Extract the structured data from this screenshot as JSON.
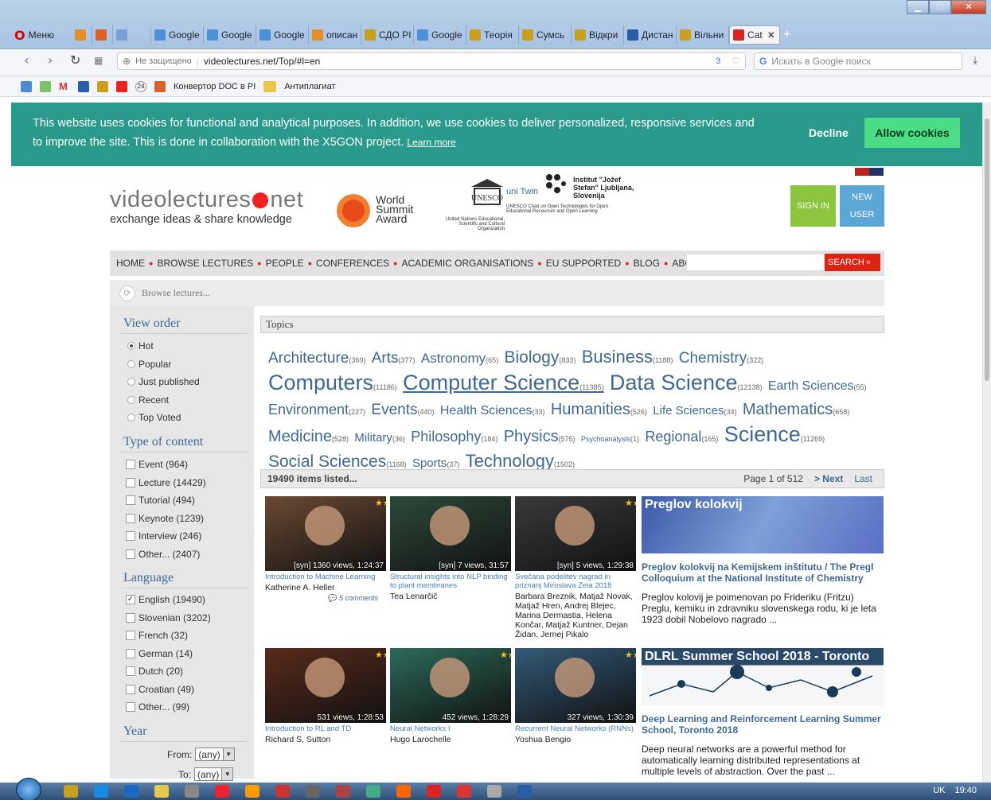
{
  "browser": {
    "menu_label": "Меню",
    "tabs": [
      "Google",
      "Google",
      "Google",
      "описан",
      "СДО PI",
      "Google",
      "Теорія",
      "Сумсь",
      "Відкри",
      "Дистан",
      "Вільни",
      "Cat"
    ],
    "address": {
      "not_secure": "Не защищено",
      "url": "videolectures.net/Top/#l=en",
      "badge": "3"
    },
    "search_placeholder": "Искать в Google поиск",
    "bookmarks": [
      "Конвертор DOC в PI",
      "Антиплагиат"
    ],
    "bookmark_badge": "24"
  },
  "cookie": {
    "text": "This website uses cookies for functional and analytical purposes. In addition, we use cookies to deliver personalized, responsive services and to improve the site. This is done in collaboration with the X5GON project.",
    "learn_more": "Learn more",
    "decline": "Decline",
    "allow": "Allow cookies"
  },
  "header": {
    "logo_main": "videolectures",
    "logo_net": "net",
    "tagline": "exchange ideas & share knowledge",
    "award": [
      "World",
      "Summit",
      "Award"
    ],
    "unesco_caption": "United Nations Educational, Scientific and Cultural Organization",
    "unesco_logo": "UNESCO",
    "unitwin_logo": "uni Twin",
    "unitwin_caption": "UNESCO Chair on Open Technologies for Open Educational Resources and Open Learning",
    "ijs": "Institut \"Jožef Stefan\" Ljubljana, Slovenija",
    "sign_in": "SIGN IN",
    "new_user": [
      "NEW",
      "USER"
    ]
  },
  "nav": {
    "items": [
      "HOME",
      "BROWSE LECTURES",
      "PEOPLE",
      "CONFERENCES",
      "ACADEMIC ORGANISATIONS",
      "EU SUPPORTED",
      "BLOG",
      "ABOUT US"
    ],
    "search": "SEARCH"
  },
  "browse": "Browse lectures...",
  "sidebar": {
    "view_order_title": "View order",
    "view_order": [
      "Hot",
      "Popular",
      "Just published",
      "Recent",
      "Top Voted"
    ],
    "type_title": "Type of content",
    "types": [
      "Event (964)",
      "Lecture (14429)",
      "Tutorial (494)",
      "Keynote (1239)",
      "Interview (246)",
      "Other... (2407)"
    ],
    "language_title": "Language",
    "languages": [
      "English (19490)",
      "Slovenian (3202)",
      "French (32)",
      "German (14)",
      "Dutch (20)",
      "Croatian (49)",
      "Other... (99)"
    ],
    "year_title": "Year",
    "from_label": "From:",
    "to_label": "To:",
    "any": "(any)"
  },
  "topics": {
    "title": "Topics",
    "items": [
      {
        "name": "Architecture",
        "count": "(369)",
        "size": 19
      },
      {
        "name": "Arts",
        "count": "(377)",
        "size": 19
      },
      {
        "name": "Astronomy",
        "count": "(65)",
        "size": 17
      },
      {
        "name": "Biology",
        "count": "(833)",
        "size": 21
      },
      {
        "name": "Business",
        "count": "(1188)",
        "size": 22
      },
      {
        "name": "Chemistry",
        "count": "(322)",
        "size": 19
      },
      {
        "name": "Computers",
        "count": "(11186)",
        "size": 27
      },
      {
        "name": "Computer Science",
        "count": "(11385)",
        "size": 27,
        "underline": true
      },
      {
        "name": "Data Science",
        "count": "(12138)",
        "size": 27
      },
      {
        "name": "Earth Sciences",
        "count": "(55)",
        "size": 16
      },
      {
        "name": "Environment",
        "count": "(227)",
        "size": 18
      },
      {
        "name": "Events",
        "count": "(440)",
        "size": 19
      },
      {
        "name": "Health Sciences",
        "count": "(33)",
        "size": 16
      },
      {
        "name": "Humanities",
        "count": "(526)",
        "size": 20
      },
      {
        "name": "Life Sciences",
        "count": "(34)",
        "size": 15
      },
      {
        "name": "Mathematics",
        "count": "(658)",
        "size": 20
      },
      {
        "name": "Medicine",
        "count": "(528)",
        "size": 20
      },
      {
        "name": "Military",
        "count": "(36)",
        "size": 15
      },
      {
        "name": "Philosophy",
        "count": "(184)",
        "size": 18
      },
      {
        "name": "Physics",
        "count": "(575)",
        "size": 20
      },
      {
        "name": "Psychoanalysis",
        "count": "(1)",
        "size": 9
      },
      {
        "name": "Regional",
        "count": "(165)",
        "size": 18
      },
      {
        "name": "Science",
        "count": "(11269)",
        "size": 27
      },
      {
        "name": "Social Sciences",
        "count": "(1168)",
        "size": 21
      },
      {
        "name": "Sports",
        "count": "(37)",
        "size": 15
      },
      {
        "name": "Technology",
        "count": "(1502)",
        "size": 22
      }
    ]
  },
  "listing": {
    "count": "19490 items listed...",
    "page": "Page 1 of 512",
    "next": "> Next",
    "last": "Last"
  },
  "cards": [
    {
      "views": "[syn] 1360 views, 1:24:37",
      "title": "Introduction to Machine Learning",
      "author": "Katherine A. Heller",
      "comments": "5 comments",
      "bg": "#6b4a34"
    },
    {
      "views": "[syn] 7 views, 31:57",
      "title": "Structural insights into NLP binding to plant membranes",
      "author": "Tea Lenarčič",
      "comments": "",
      "bg": "#2d4a3a"
    },
    {
      "views": "[syn] 5 views, 1:29:38",
      "title": "Svečana podelitev nagrad in priznanj Miroslava Zeia 2018",
      "author": "Barbara Breznik, Matjaž Novak, Matjaž Hren, Andrej Blejec, Marina Dermastia, Helena Končar, Matjaž Kuntner, Dejan Židan, Jernej Pikalo",
      "comments": "",
      "bg": "#3a3a3a"
    },
    {
      "views": "531 views, 1:28:53",
      "title": "Introduction to RL and TD",
      "author": "Richard S. Sutton",
      "comments": "",
      "bg": "#5a2a1c"
    },
    {
      "views": "452 views, 1:28:29",
      "title": "Neural Networks I",
      "author": "Hugo Larochelle",
      "comments": "",
      "bg": "#2c6a5a"
    },
    {
      "views": "327 views, 1:30:39",
      "title": "Recurrent Neural Networks (RNNs)",
      "author": "Yoshua Bengio",
      "comments": "",
      "bg": "#335a78"
    }
  ],
  "featured": [
    {
      "img_title": "Preglov kolokvij",
      "heading": "Preglov kolokvij na Kemijskem inštitutu / The Pregl Colloquium at the National Institute of Chemistry",
      "desc": "Preglov kolovij je poimenovan po Frideriku (Fritzu) Preglu, kemiku in zdravniku slovenskega rodu, ki je leta 1923 dobil Nobelovo nagrado ..."
    },
    {
      "img_title": "DLRL Summer School 2018 - Toronto",
      "heading": "Deep Learning and Reinforcement Learning Summer School, Toronto 2018",
      "desc": "Deep neural networks are a powerful method for automatically learning distributed representations at multiple levels of abstraction. Over the past ..."
    }
  ],
  "taskbar": {
    "lang": "UK",
    "time": "19:40"
  }
}
